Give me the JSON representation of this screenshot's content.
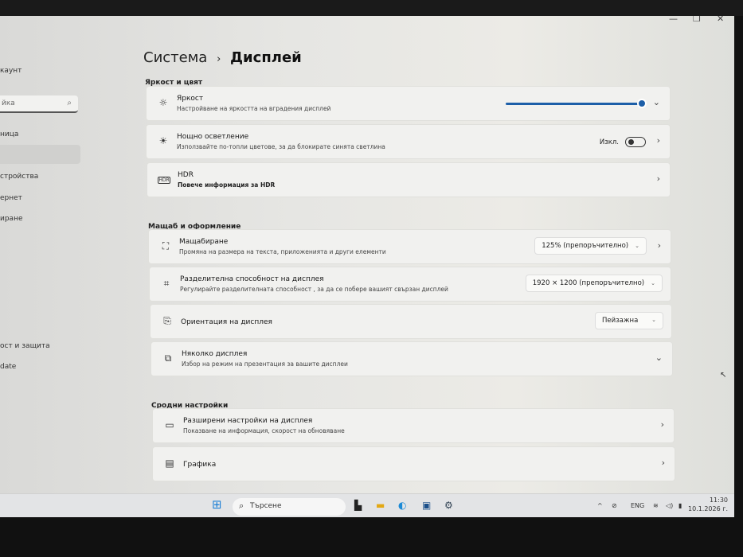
{
  "window": {
    "minimize": "—",
    "restore": "❐",
    "close": "✕"
  },
  "sidebar": {
    "account_partial": "каунт",
    "search_partial": "йка",
    "items_partial": [
      "ница",
      "стройства",
      "ернет",
      "иране",
      "ост и защита",
      "date"
    ]
  },
  "breadcrumb": {
    "parent": "Система",
    "separator": "›",
    "current": "Дисплей"
  },
  "sections": {
    "brightness_color": "Яркост и цвят",
    "scale_layout": "Мащаб и оформление",
    "related": "Сродни настройки"
  },
  "brightness": {
    "title": "Яркост",
    "subtitle": "Настройване на яркостта на вградения дисплей",
    "value_percent": 100
  },
  "night_light": {
    "title": "Нощно осветление",
    "subtitle": "Използвайте по-топли цветове, за да блокирате синята светлина",
    "state": "Изкл."
  },
  "hdr": {
    "title": "HDR",
    "subtitle": "Повече информация за HDR",
    "icon_text": "HDR"
  },
  "scale": {
    "title": "Мащабиране",
    "subtitle": "Промяна на размера на текста, приложенията и други елементи",
    "value": "125% (препоръчително)"
  },
  "resolution": {
    "title": "Разделителна способност на дисплея",
    "subtitle": "Регулирайте разделителната способност , за да се побере вашият свързан дисплей",
    "value": "1920 × 1200 (препоръчително)"
  },
  "orientation": {
    "title": "Ориентация на дисплея",
    "value": "Пейзажна"
  },
  "multiple": {
    "title": "Няколко дисплея",
    "subtitle": "Избор на режим на презентация за вашите дисплеи"
  },
  "advanced": {
    "title": "Разширени настройки на дисплея",
    "subtitle": "Показване на информация, скорост на обновяване"
  },
  "graphics": {
    "title": "Графика"
  },
  "taskbar": {
    "search": "Търсене",
    "lang": "ENG",
    "time": "11:30",
    "date": "10.1.2026 г."
  }
}
